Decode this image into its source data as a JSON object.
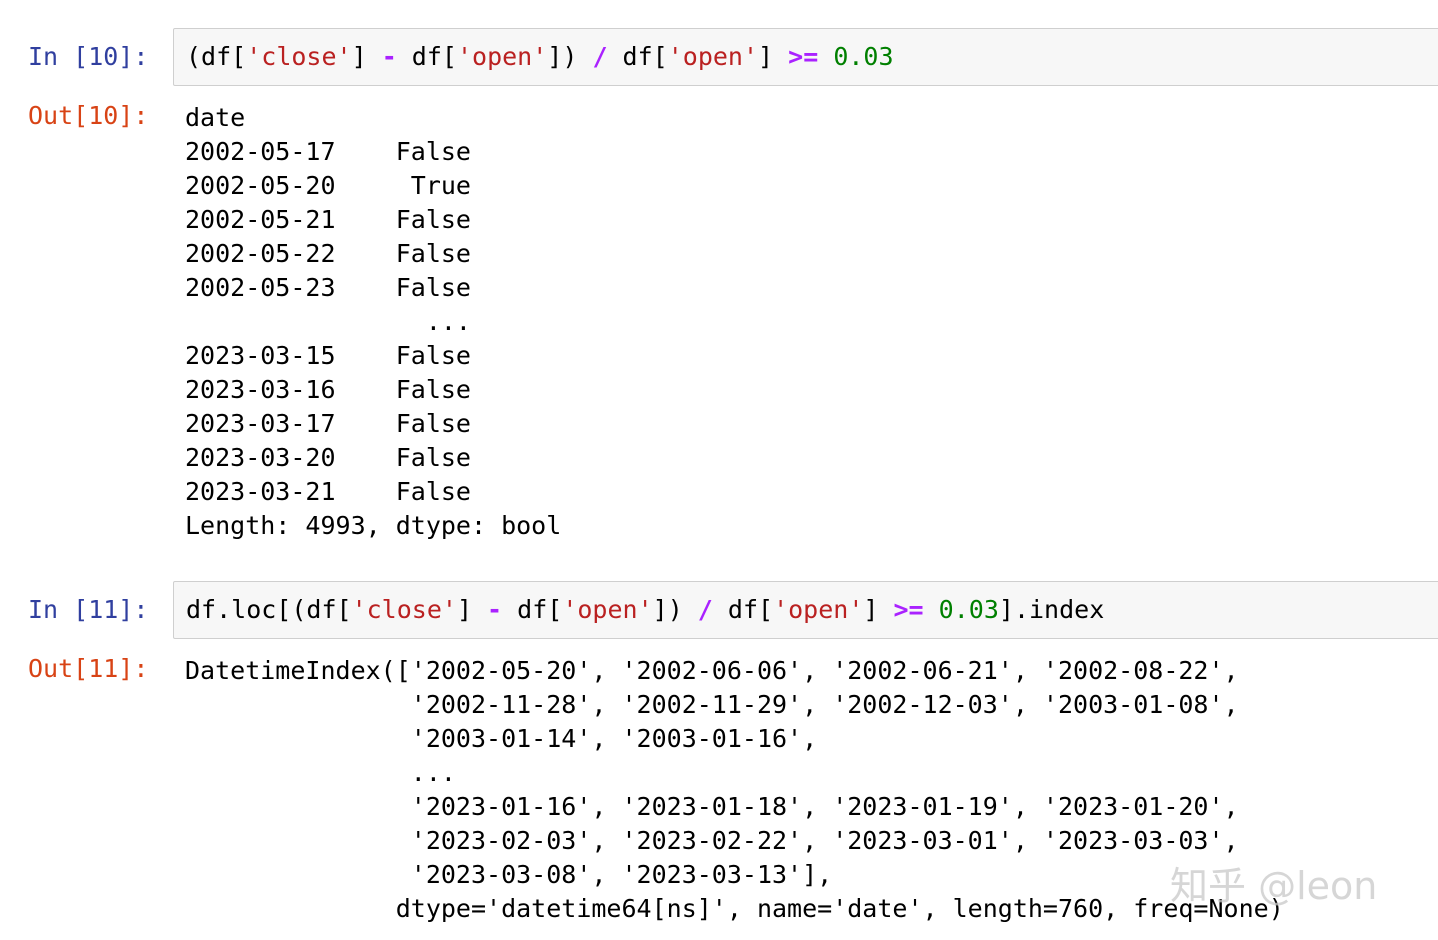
{
  "cells": [
    {
      "in_prompt": "In [10]:",
      "code_tokens": [
        {
          "text": "(df[",
          "type": "plain"
        },
        {
          "text": "'close'",
          "type": "str"
        },
        {
          "text": "] ",
          "type": "plain"
        },
        {
          "text": "-",
          "type": "op"
        },
        {
          "text": " df[",
          "type": "plain"
        },
        {
          "text": "'open'",
          "type": "str"
        },
        {
          "text": "]) ",
          "type": "plain"
        },
        {
          "text": "/",
          "type": "op"
        },
        {
          "text": " df[",
          "type": "plain"
        },
        {
          "text": "'open'",
          "type": "str"
        },
        {
          "text": "] ",
          "type": "plain"
        },
        {
          "text": ">=",
          "type": "op"
        },
        {
          "text": " ",
          "type": "plain"
        },
        {
          "text": "0.03",
          "type": "num"
        }
      ],
      "out_prompt": "Out[10]:",
      "output": "date\n2002-05-17    False\n2002-05-20     True\n2002-05-21    False\n2002-05-22    False\n2002-05-23    False\n                ...  \n2023-03-15    False\n2023-03-16    False\n2023-03-17    False\n2023-03-20    False\n2023-03-21    False\nLength: 4993, dtype: bool"
    },
    {
      "in_prompt": "In [11]:",
      "code_tokens": [
        {
          "text": "df.loc[(df[",
          "type": "plain"
        },
        {
          "text": "'close'",
          "type": "str"
        },
        {
          "text": "] ",
          "type": "plain"
        },
        {
          "text": "-",
          "type": "op"
        },
        {
          "text": " df[",
          "type": "plain"
        },
        {
          "text": "'open'",
          "type": "str"
        },
        {
          "text": "]) ",
          "type": "plain"
        },
        {
          "text": "/",
          "type": "op"
        },
        {
          "text": " df[",
          "type": "plain"
        },
        {
          "text": "'open'",
          "type": "str"
        },
        {
          "text": "] ",
          "type": "plain"
        },
        {
          "text": ">=",
          "type": "op"
        },
        {
          "text": " ",
          "type": "plain"
        },
        {
          "text": "0.03",
          "type": "num"
        },
        {
          "text": "].index",
          "type": "plain"
        }
      ],
      "out_prompt": "Out[11]:",
      "output": "DatetimeIndex(['2002-05-20', '2002-06-06', '2002-06-21', '2002-08-22',\n               '2002-11-28', '2002-11-29', '2002-12-03', '2003-01-08',\n               '2003-01-14', '2003-01-16',\n               ...\n               '2023-01-16', '2023-01-18', '2023-01-19', '2023-01-20',\n               '2023-02-03', '2023-02-22', '2023-03-01', '2023-03-03',\n               '2023-03-08', '2023-03-13'],\n              dtype='datetime64[ns]', name='date', length=760, freq=None)"
    }
  ],
  "watermark": "知乎 @leon",
  "colors": {
    "in_prompt": "#303f9f",
    "out_prompt": "#d84315",
    "string": "#ba2121",
    "operator": "#aa22ff",
    "number": "#008000",
    "input_bg": "#f7f7f7"
  }
}
